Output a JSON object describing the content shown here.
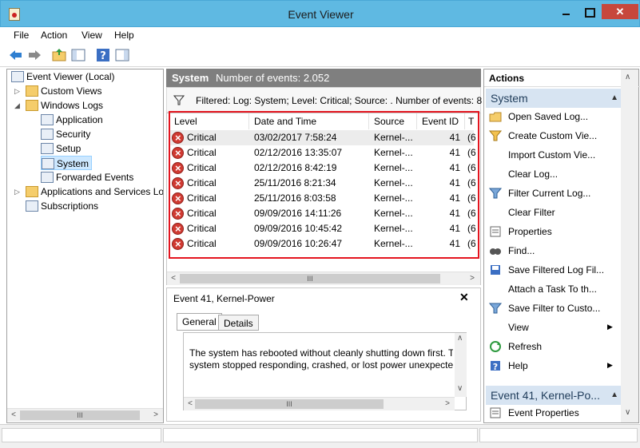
{
  "window": {
    "title": "Event Viewer"
  },
  "menu": [
    "File",
    "Action",
    "View",
    "Help"
  ],
  "tree": {
    "root": "Event Viewer (Local)",
    "custom_views": "Custom Views",
    "windows_logs": "Windows Logs",
    "logs": [
      "Application",
      "Security",
      "Setup",
      "System",
      "Forwarded Events"
    ],
    "apps_services": "Applications and Services Lo",
    "subscriptions": "Subscriptions"
  },
  "center": {
    "title": "System",
    "count": "Number of events: 2.052",
    "filter": "Filtered: Log: System; Level: Critical; Source: . Number of events: 8",
    "columns": [
      "Level",
      "Date and Time",
      "Source",
      "Event ID",
      "T"
    ],
    "rows": [
      {
        "level": "Critical",
        "date": "03/02/2017 7:58:24",
        "source": "Kernel-...",
        "id": "41",
        "t": "(6"
      },
      {
        "level": "Critical",
        "date": "02/12/2016 13:35:07",
        "source": "Kernel-...",
        "id": "41",
        "t": "(6"
      },
      {
        "level": "Critical",
        "date": "02/12/2016 8:42:19",
        "source": "Kernel-...",
        "id": "41",
        "t": "(6"
      },
      {
        "level": "Critical",
        "date": "25/11/2016 8:21:34",
        "source": "Kernel-...",
        "id": "41",
        "t": "(6"
      },
      {
        "level": "Critical",
        "date": "25/11/2016 8:03:58",
        "source": "Kernel-...",
        "id": "41",
        "t": "(6"
      },
      {
        "level": "Critical",
        "date": "09/09/2016 14:11:26",
        "source": "Kernel-...",
        "id": "41",
        "t": "(6"
      },
      {
        "level": "Critical",
        "date": "09/09/2016 10:45:42",
        "source": "Kernel-...",
        "id": "41",
        "t": "(6"
      },
      {
        "level": "Critical",
        "date": "09/09/2016 10:26:47",
        "source": "Kernel-...",
        "id": "41",
        "t": "(6"
      }
    ]
  },
  "detail": {
    "title": "Event 41, Kernel-Power",
    "tabs": [
      "General",
      "Details"
    ],
    "text_line1": "The system has rebooted without cleanly shutting down first. T",
    "text_line2": "system stopped responding, crashed, or lost power unexpected"
  },
  "actions": {
    "header": "Actions",
    "section1": "System",
    "items": [
      "Open Saved Log...",
      "Create Custom Vie...",
      "Import Custom Vie...",
      "Clear Log...",
      "Filter Current Log...",
      "Clear Filter",
      "Properties",
      "Find...",
      "Save Filtered Log Fil...",
      "Attach a Task To th...",
      "Save Filter to Custo...",
      "View",
      "Refresh",
      "Help"
    ],
    "section2": "Event 41, Kernel-Po...",
    "section2_items": [
      "Event Properties"
    ]
  },
  "colors": {
    "titlebar": "#5fb9e2",
    "close": "#c7473c",
    "highlight_box": "#e4151f",
    "critical": "#d03a32"
  }
}
